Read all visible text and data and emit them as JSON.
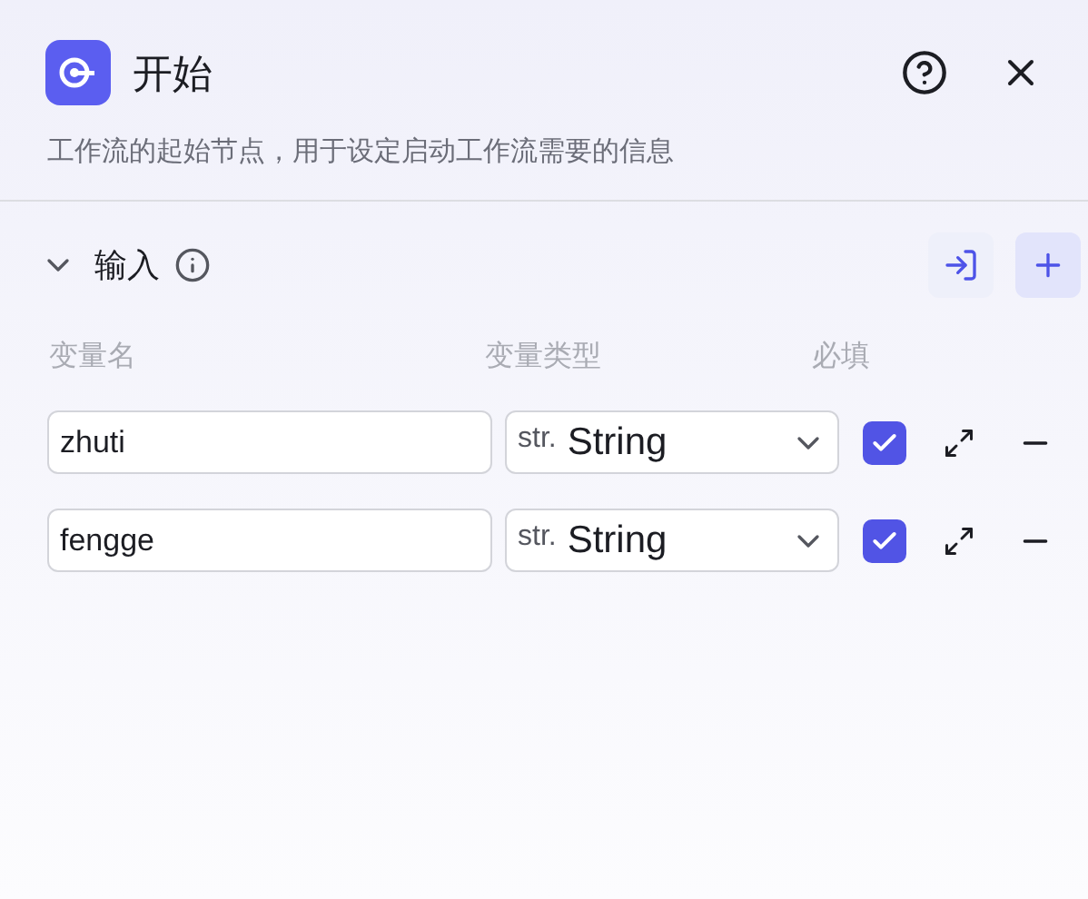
{
  "header": {
    "title": "开始",
    "description": "工作流的起始节点，用于设定启动工作流需要的信息"
  },
  "section": {
    "title": "输入",
    "expanded": true
  },
  "columns": [
    "变量名",
    "变量类型",
    "必填"
  ],
  "variables": [
    {
      "name": "zhuti",
      "type_prefix": "str.",
      "type": "String",
      "required": true
    },
    {
      "name": "fengge",
      "type_prefix": "str.",
      "type": "String",
      "required": true
    }
  ]
}
